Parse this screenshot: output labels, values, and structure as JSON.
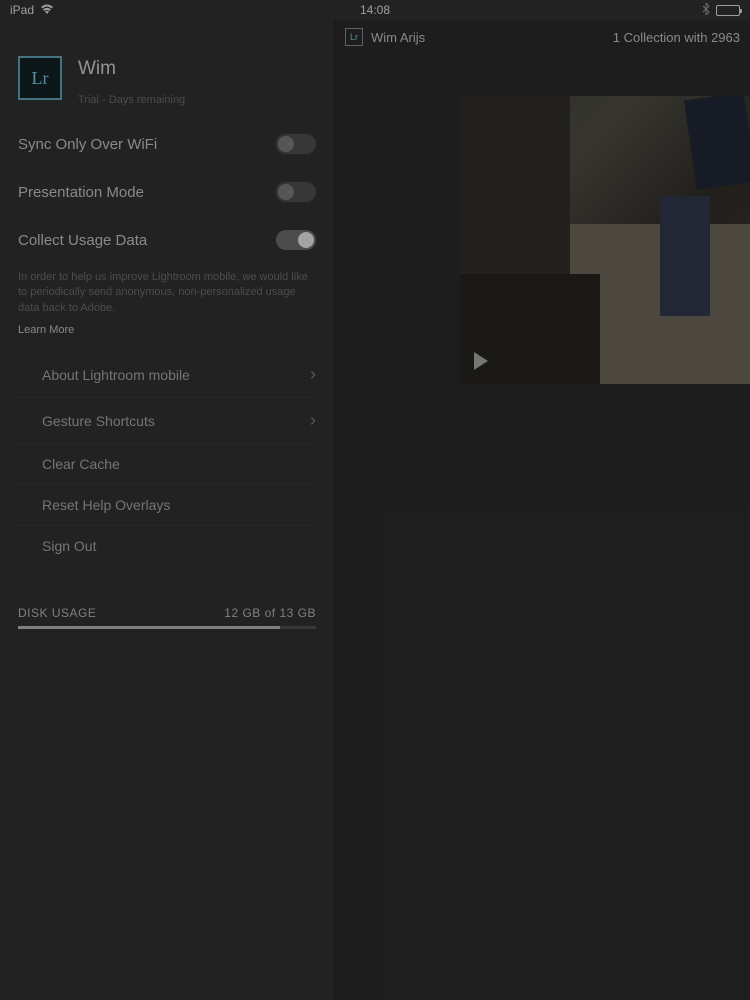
{
  "status": {
    "device": "iPad",
    "time": "14:08"
  },
  "profile": {
    "badge": "Lr",
    "name": "Wim",
    "subtitle": "Trial - Days remaining"
  },
  "settings": {
    "sync_wifi": {
      "label": "Sync Only Over WiFi",
      "on": false
    },
    "presentation": {
      "label": "Presentation Mode",
      "on": false
    },
    "usage_data": {
      "label": "Collect Usage Data",
      "on": true
    }
  },
  "info_text": "In order to help us improve Lightroom mobile, we would like to periodically send anonymous, non-personalized usage data back to Adobe.",
  "learn_more": "Learn More",
  "menu": {
    "about": "About Lightroom mobile",
    "gestures": "Gesture Shortcuts",
    "clear_cache": "Clear Cache",
    "reset_overlays": "Reset Help Overlays",
    "sign_out": "Sign Out"
  },
  "disk": {
    "title": "DISK USAGE",
    "value": "12 GB of 13 GB",
    "percent": 88
  },
  "main": {
    "badge": "Lr",
    "user": "Wim Arijs",
    "collection": "1 Collection with 2963"
  }
}
